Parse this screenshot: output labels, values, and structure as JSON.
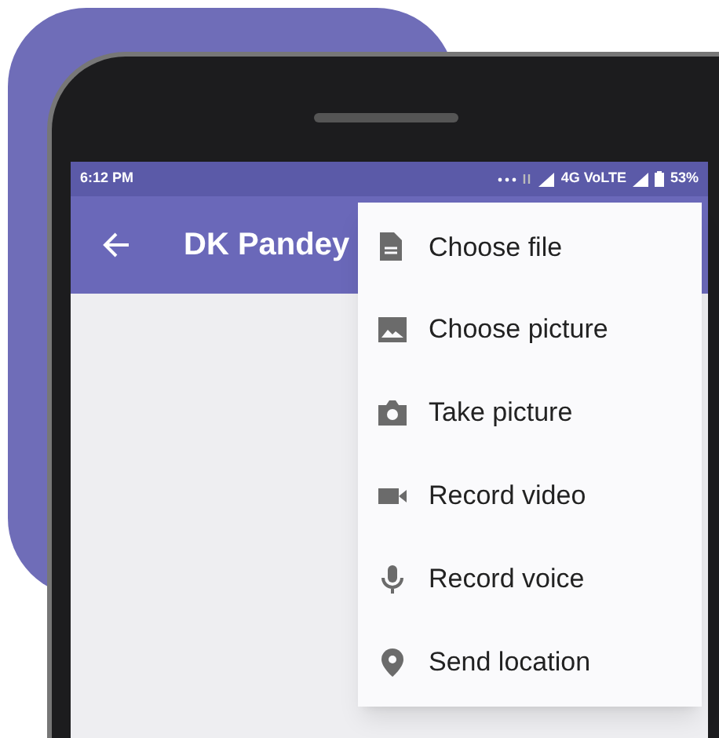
{
  "status_bar": {
    "time": "6:12 PM",
    "network": "4G VoLTE",
    "battery": "53%"
  },
  "app_bar": {
    "title": "DK Pandey"
  },
  "menu": {
    "items": [
      {
        "label": "Choose file",
        "kind": "file"
      },
      {
        "label": "Choose picture",
        "kind": "image"
      },
      {
        "label": "Take picture",
        "kind": "camera"
      },
      {
        "label": "Record video",
        "kind": "video"
      },
      {
        "label": "Record voice",
        "kind": "mic"
      },
      {
        "label": "Send location",
        "kind": "location"
      }
    ]
  }
}
